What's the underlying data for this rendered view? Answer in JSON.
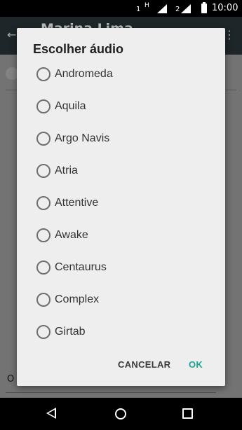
{
  "status_bar": {
    "sim1": "1",
    "network_type": "H",
    "sim2": "2",
    "time": "10:00"
  },
  "background_app": {
    "title": "Marina Lima",
    "bottom_text": "O"
  },
  "dialog": {
    "title": "Escolher áudio",
    "options": [
      {
        "label": "Andromeda",
        "selected": false
      },
      {
        "label": "Aquila",
        "selected": false
      },
      {
        "label": "Argo Navis",
        "selected": false
      },
      {
        "label": "Atria",
        "selected": false
      },
      {
        "label": "Attentive",
        "selected": false
      },
      {
        "label": "Awake",
        "selected": false
      },
      {
        "label": "Centaurus",
        "selected": false
      },
      {
        "label": "Complex",
        "selected": false
      },
      {
        "label": "Girtab",
        "selected": false
      }
    ],
    "cancel_label": "CANCELAR",
    "ok_label": "OK",
    "ok_color": "#1aa592"
  }
}
